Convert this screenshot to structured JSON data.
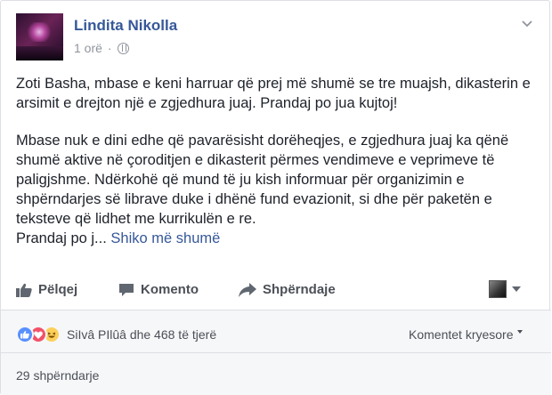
{
  "post": {
    "author": "Lindita Nikolla",
    "time": "1 orë",
    "separator": "·",
    "paragraph1": "Zoti Basha, mbase e keni harruar që prej më shumë se tre muajsh, dikasterin e arsimit e drejton një e zgjedhura juaj. Prandaj po jua kujtoj!",
    "paragraph2": "Mbase nuk e dini edhe që pavarësisht dorëheqjes, e zgjedhura juaj ka qënë shumë aktive në çoroditjen e dikasterit përmes vendimeve e veprimeve të paligjshme. Ndërkohë që mund të ju kish informuar për organizimin e shpërndarjes së librave duke i dhënë fund evazionit, si dhe për paketën e teksteve që lidhet me kurrikulën e re.",
    "paragraph3_start": "Prandaj po j...",
    "see_more": "Shiko më shumë"
  },
  "actions": {
    "like": "Pëlqej",
    "comment": "Komento",
    "share": "Shpërndaje"
  },
  "footer": {
    "reactions_text": "SiIvâ PIlûâ dhe 468 të tjerë",
    "sort_label": "Komentet kryesore",
    "shares": "29 shpërndarje"
  },
  "icons": {
    "globe": "globe-icon",
    "chevron": "chevron-down-icon",
    "like": "thumbs-up-icon",
    "comment": "comment-icon",
    "share": "share-arrow-icon",
    "reaction_like": "like-reaction-icon",
    "reaction_love": "love-reaction-icon",
    "reaction_haha": "haha-reaction-icon"
  },
  "colors": {
    "link": "#365899",
    "text": "#1d2129",
    "muted": "#90949c",
    "like_blue": "#5890ff",
    "love_red": "#f25268",
    "haha_yellow": "#fcd05b"
  }
}
